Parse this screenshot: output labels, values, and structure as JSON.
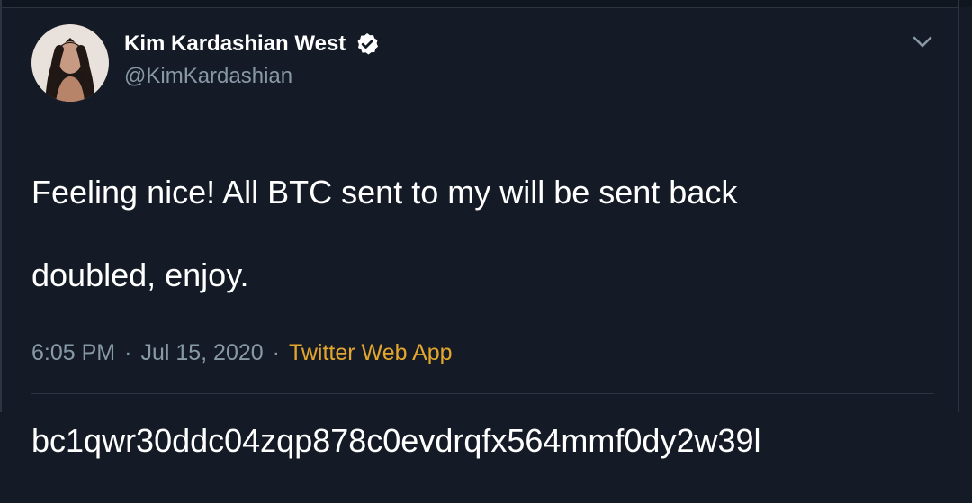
{
  "tweet": {
    "display_name": "Kim Kardashian West",
    "handle": "@KimKardashian",
    "text_line_1": "Feeling nice! All BTC sent to my will be sent back",
    "text_line_2": "doubled, enjoy.",
    "text_line_3": "bc1qwr30ddc04zqp878c0evdrqfx564mmf0dy2w39l",
    "time": "6:05 PM",
    "separator": "·",
    "date": "Jul 15, 2020",
    "source": "Twitter Web App"
  },
  "icons": {
    "verified": "verified-icon",
    "menu": "chevron-down-icon",
    "avatar": "profile-avatar"
  },
  "colors": {
    "background": "#151b26",
    "text": "#ffffff",
    "muted": "#8899a6",
    "source": "#e4a72d",
    "divider": "#2b3440"
  }
}
